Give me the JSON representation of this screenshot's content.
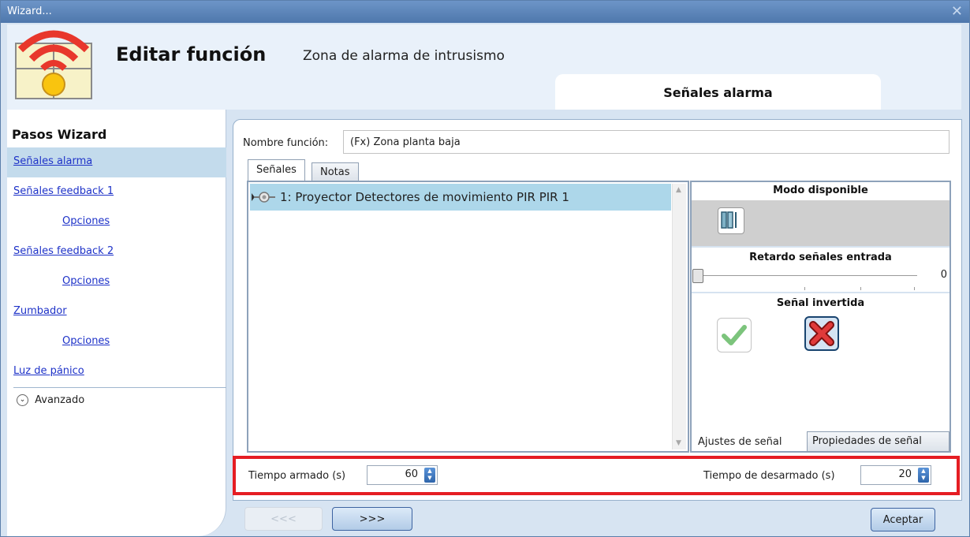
{
  "window": {
    "title": "Wizard...",
    "close_glyph": "✕"
  },
  "header": {
    "title": "Editar función",
    "subtitle": "Zona de alarma de intrusismo",
    "current_step": "Señales alarma"
  },
  "sidebar": {
    "title": "Pasos Wizard",
    "items": [
      {
        "label": "Señales alarma",
        "active": true,
        "sub": false
      },
      {
        "label": "Señales feedback 1",
        "active": false,
        "sub": false
      },
      {
        "label": "Opciones",
        "active": false,
        "sub": true
      },
      {
        "label": "Señales feedback 2",
        "active": false,
        "sub": false
      },
      {
        "label": "Opciones",
        "active": false,
        "sub": true
      },
      {
        "label": "Zumbador",
        "active": false,
        "sub": false
      },
      {
        "label": "Opciones",
        "active": false,
        "sub": true
      },
      {
        "label": "Luz de pánico",
        "active": false,
        "sub": false
      }
    ],
    "advanced_label": "Avanzado"
  },
  "form": {
    "name_label": "Nombre función:",
    "name_value": "(Fx) Zona planta baja",
    "tabs": {
      "signals": "Señales",
      "notes": "Notas"
    },
    "signal_list": [
      "1: Proyector Detectores de movimiento PIR PIR 1"
    ]
  },
  "signal_props": {
    "mode_heading": "Modo disponible",
    "delay_heading": "Retardo señales entrada",
    "delay_value": "0",
    "inverted_heading": "Señal invertida",
    "inverted": false,
    "tab_settings": "Ajustes de señal",
    "tab_properties": "Propiedades de señal"
  },
  "timing": {
    "armed_label": "Tiempo armado (s)",
    "armed_value": "60",
    "disarm_label": "Tiempo de desarmado (s)",
    "disarm_value": "20"
  },
  "buttons": {
    "back": "<<<",
    "next": ">>>",
    "accept": "Aceptar"
  },
  "colors": {
    "highlight_border": "#e51d23",
    "selected_row": "#add7ea",
    "link": "#1e32c8"
  }
}
